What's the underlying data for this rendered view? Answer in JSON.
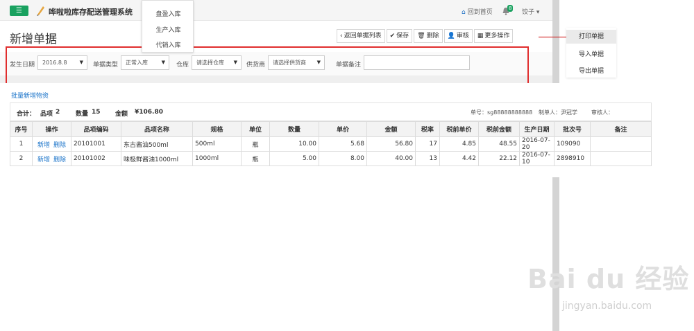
{
  "navbar": {
    "app_title": "哗啦啦库存配送管理系统",
    "home_label": "回到首页",
    "notification_count": "8",
    "user_label": "饺子 ▾"
  },
  "dropdown_top": {
    "items": [
      "盘盈入库",
      "生产入库",
      "代销入库"
    ]
  },
  "header": {
    "title": "新增单据",
    "buttons": [
      {
        "icon": "‹",
        "label": "返回单据列表"
      },
      {
        "icon": "✔",
        "label": "保存"
      },
      {
        "icon": "🗑",
        "label": "删除"
      },
      {
        "icon": "👤",
        "label": "审核"
      },
      {
        "icon": "▦",
        "label": "更多操作"
      }
    ]
  },
  "more_menu": {
    "items": [
      "打印单据",
      "导入单据",
      "导出单据"
    ]
  },
  "filters": {
    "date_label": "发生日期",
    "date_value": "2016.8.8",
    "type_label": "单据类型",
    "type_value": "正常入库",
    "warehouse_label": "仓库",
    "warehouse_value": "请选择仓库",
    "supplier_label": "供货商",
    "supplier_value": "请选择供货商",
    "remark_label": "单据备注",
    "remark_value": ""
  },
  "content": {
    "batch_link": "批量新增物资",
    "summary": {
      "total_label": "合计：",
      "items_label": "品项",
      "items_value": "2",
      "qty_label": "数量",
      "qty_value": "15",
      "amount_label": "金额",
      "amount_value": "¥106.80",
      "doc_no": "单号：sg88888888888",
      "maker": "制单人：尹冠学",
      "auditor": "审核人："
    },
    "columns": [
      "序号",
      "操作",
      "品项编码",
      "品项名称",
      "规格",
      "单位",
      "数量",
      "单价",
      "金额",
      "税率",
      "税前单价",
      "税前金额",
      "生产日期",
      "批次号",
      "备注"
    ],
    "rows": [
      {
        "no": "1",
        "add": "新增",
        "del": "删除",
        "code": "20101001",
        "name": "东古酱油500ml",
        "spec": "500ml",
        "unit": "瓶",
        "qty": "10.00",
        "price": "5.68",
        "amount": "56.80",
        "tax": "17",
        "pre_price": "4.85",
        "pre_amount": "48.55",
        "date": "2016-07-20",
        "batch": "109090",
        "note": ""
      },
      {
        "no": "2",
        "add": "新增",
        "del": "删除",
        "code": "20101002",
        "name": "味极鲜酱油1000ml",
        "spec": "1000ml",
        "unit": "瓶",
        "qty": "5.00",
        "price": "8.00",
        "amount": "40.00",
        "tax": "13",
        "pre_price": "4.42",
        "pre_amount": "22.12",
        "date": "2016-07-10",
        "batch": "2898910",
        "note": ""
      }
    ]
  },
  "watermark": {
    "main": "Bai du 经验",
    "sub": "jingyan.baidu.com"
  },
  "colors": {
    "accent": "#19a15f",
    "link": "#1a73c9",
    "highlight": "#e02d2d"
  }
}
